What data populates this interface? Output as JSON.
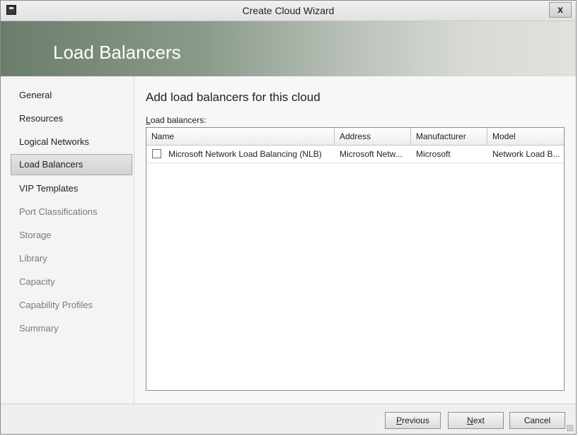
{
  "window": {
    "title": "Create Cloud Wizard",
    "close_label": "x"
  },
  "banner": {
    "title": "Load Balancers"
  },
  "sidebar": {
    "items": [
      {
        "label": "General",
        "state": "enabled"
      },
      {
        "label": "Resources",
        "state": "enabled"
      },
      {
        "label": "Logical Networks",
        "state": "enabled"
      },
      {
        "label": "Load Balancers",
        "state": "active"
      },
      {
        "label": "VIP Templates",
        "state": "enabled"
      },
      {
        "label": "Port Classifications",
        "state": "disabled"
      },
      {
        "label": "Storage",
        "state": "disabled"
      },
      {
        "label": "Library",
        "state": "disabled"
      },
      {
        "label": "Capacity",
        "state": "disabled"
      },
      {
        "label": "Capability Profiles",
        "state": "disabled"
      },
      {
        "label": "Summary",
        "state": "disabled"
      }
    ]
  },
  "main": {
    "heading": "Add load balancers for this cloud",
    "list_label_access": "L",
    "list_label_rest": "oad balancers:",
    "columns": [
      "Name",
      "Address",
      "Manufacturer",
      "Model"
    ],
    "rows": [
      {
        "checked": false,
        "name": "Microsoft Network Load Balancing (NLB)",
        "address": "Microsoft Netw...",
        "manufacturer": "Microsoft",
        "model": "Network Load B..."
      }
    ]
  },
  "footer": {
    "previous_access": "P",
    "previous_rest": "revious",
    "next_access": "N",
    "next_rest": "ext",
    "cancel_label": "Cancel"
  },
  "colors": {
    "banner_start": "#6b7d6c",
    "banner_end": "#e0e2de",
    "active_nav": "#d8d8d8"
  }
}
